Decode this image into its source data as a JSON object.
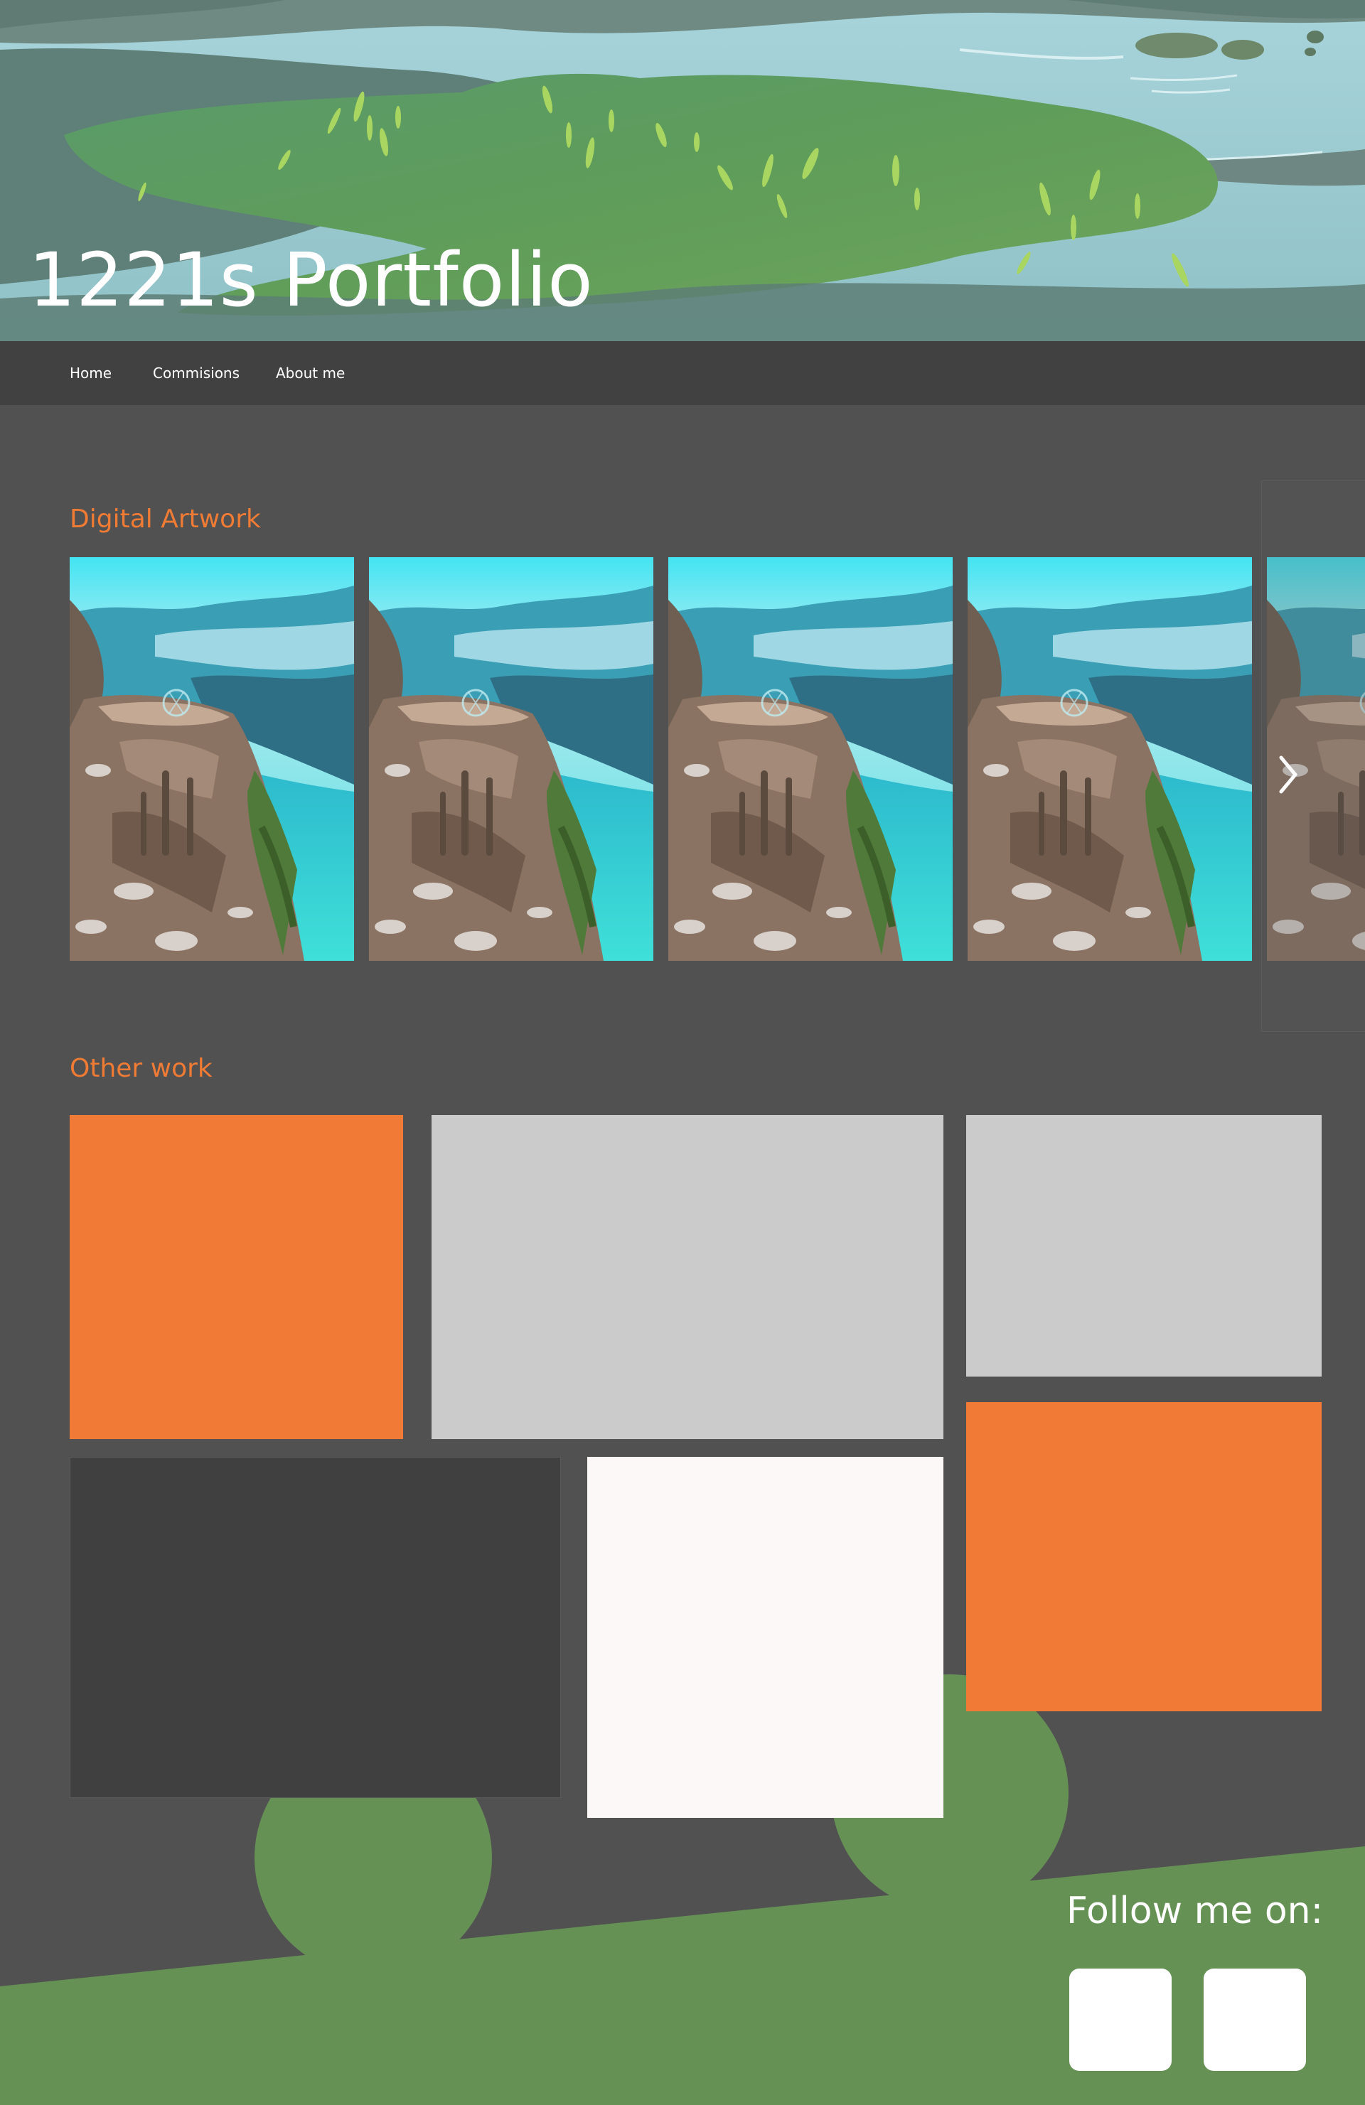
{
  "hero": {
    "title": "1221s Portfolio"
  },
  "nav": {
    "items": [
      {
        "label": "Home"
      },
      {
        "label": "Commisions"
      },
      {
        "label": "About me"
      }
    ]
  },
  "digital_artwork": {
    "heading": "Digital Artwork",
    "thumbnail_count": 5,
    "next_icon": "chevron-right-icon"
  },
  "other_work": {
    "heading": "Other work",
    "tiles": [
      {
        "color": "#f17b36"
      },
      {
        "color": "#cccbcc"
      },
      {
        "color": "#cccbcc"
      },
      {
        "color": "#f17b36"
      },
      {
        "color": "#404040"
      },
      {
        "color": "#fcf8f8"
      }
    ]
  },
  "footer": {
    "follow_label": "Follow me on:",
    "social_buttons": [
      {
        "icon": "social-icon"
      },
      {
        "icon": "social-icon"
      }
    ]
  },
  "colors": {
    "background": "#515151",
    "nav": "#414141",
    "accent": "#f07b35",
    "footer_green": "#669155"
  }
}
